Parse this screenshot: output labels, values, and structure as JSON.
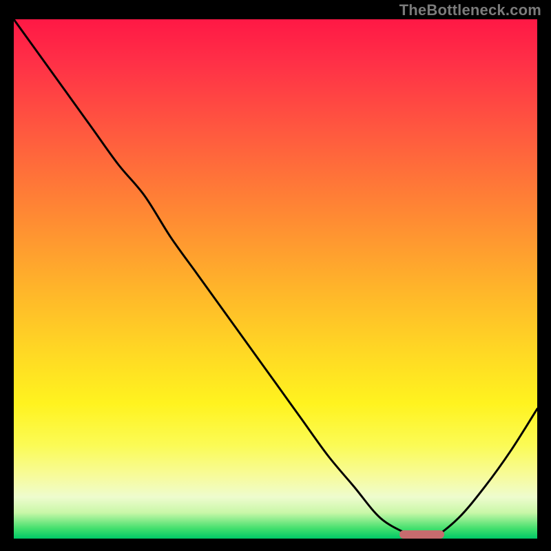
{
  "watermark": "TheBottleneck.com",
  "chart_data": {
    "type": "line",
    "title": "",
    "xlabel": "",
    "ylabel": "",
    "xlim": [
      0,
      100
    ],
    "ylim": [
      0,
      100
    ],
    "x": [
      0,
      5,
      10,
      15,
      20,
      25,
      30,
      35,
      40,
      45,
      50,
      55,
      60,
      65,
      70,
      75,
      78,
      80,
      85,
      90,
      95,
      100
    ],
    "values": [
      100,
      93,
      86,
      79,
      72,
      66,
      58,
      51,
      44,
      37,
      30,
      23,
      16,
      10,
      4,
      1,
      0,
      0,
      4,
      10,
      17,
      25
    ],
    "gradient_stops": [
      {
        "pos": 0,
        "color": "#ff1845"
      },
      {
        "pos": 8,
        "color": "#ff2f47"
      },
      {
        "pos": 22,
        "color": "#ff5a3f"
      },
      {
        "pos": 38,
        "color": "#ff8a33"
      },
      {
        "pos": 52,
        "color": "#ffb52a"
      },
      {
        "pos": 64,
        "color": "#ffd824"
      },
      {
        "pos": 74,
        "color": "#fff31f"
      },
      {
        "pos": 82,
        "color": "#fbfb55"
      },
      {
        "pos": 88,
        "color": "#f7fb9c"
      },
      {
        "pos": 92,
        "color": "#eefcce"
      },
      {
        "pos": 95,
        "color": "#c9f7a8"
      },
      {
        "pos": 98,
        "color": "#45e06e"
      },
      {
        "pos": 100,
        "color": "#00c867"
      }
    ],
    "marker": {
      "x_start": 74,
      "x_end": 82,
      "y": 0,
      "color": "#c86b6e"
    }
  }
}
